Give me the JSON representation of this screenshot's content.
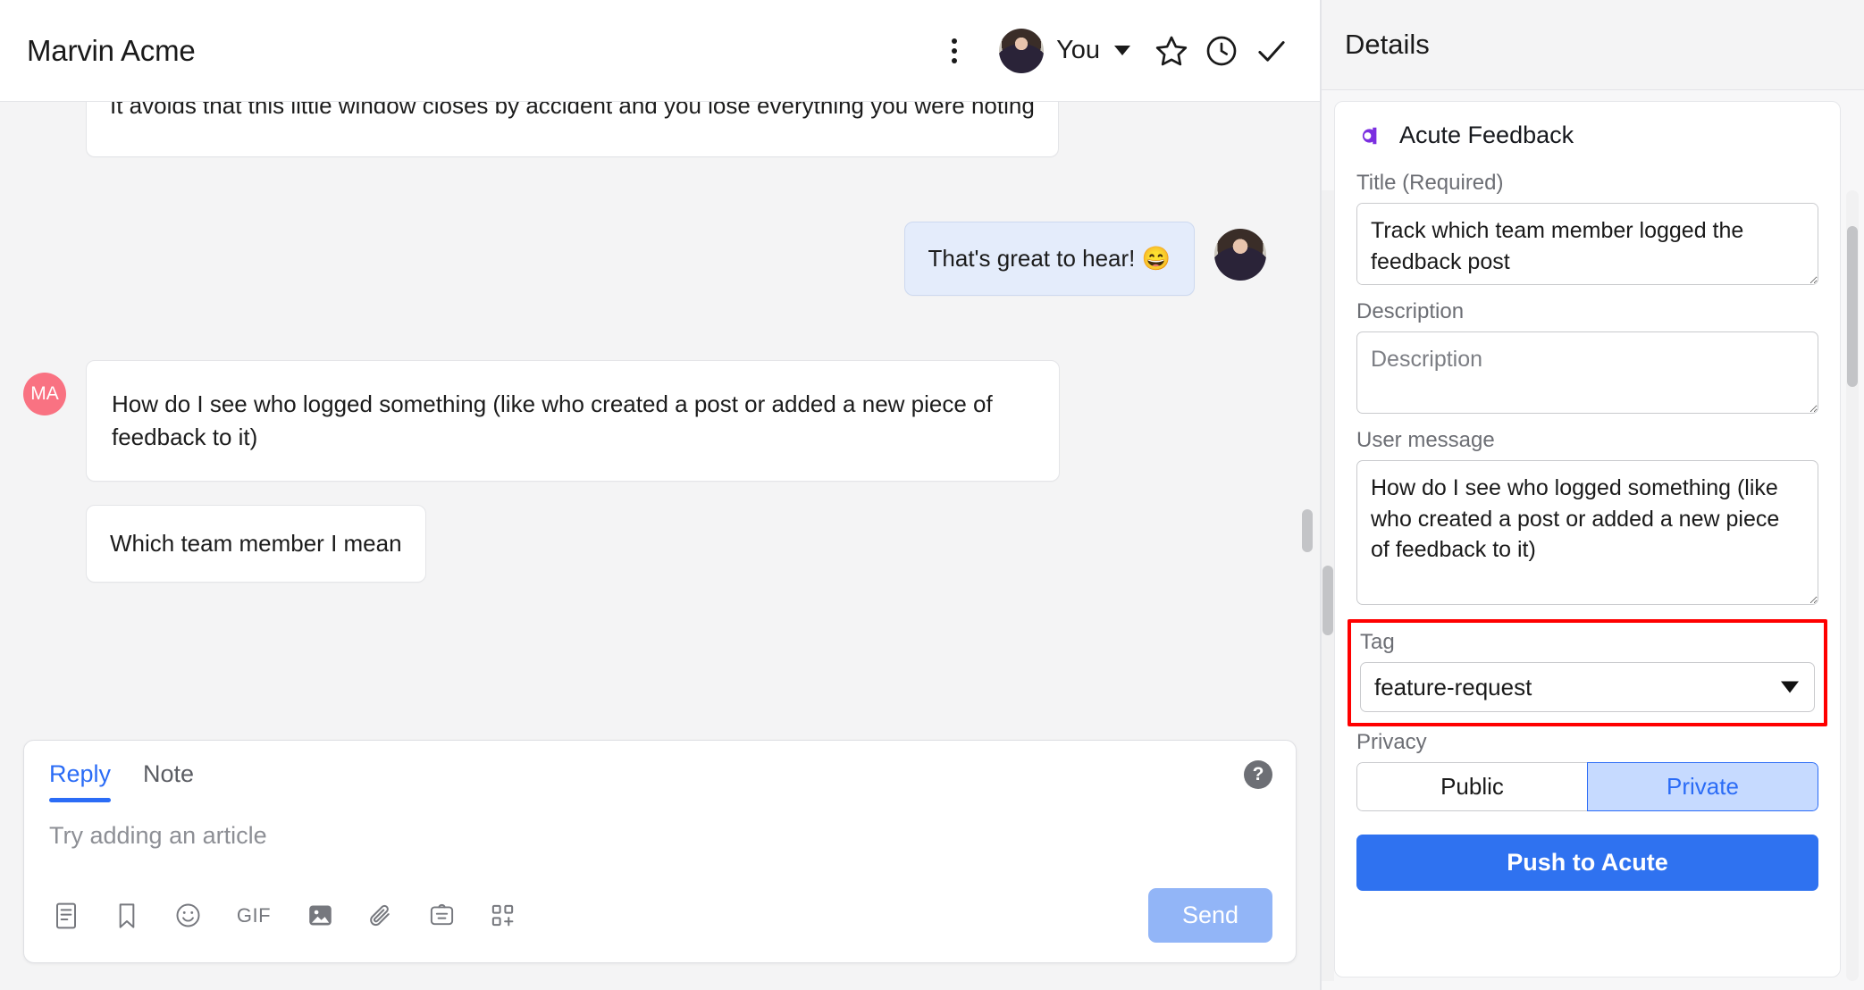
{
  "conversation": {
    "title": "Marvin Acme",
    "header_actions": {
      "more_icon": "kebab-menu-icon",
      "assignee_label": "You",
      "assignee_caret_icon": "chevron-down-icon",
      "star_icon": "star-icon",
      "snooze_icon": "clock-icon",
      "close_icon": "check-icon"
    },
    "messages": [
      {
        "id": "m1",
        "direction": "inbound",
        "clipped_top": true,
        "avatar": "",
        "text": "It avoids that this little window closes by accident and you lose everything you were noting"
      },
      {
        "id": "m2",
        "direction": "outbound",
        "avatar": "you-avatar",
        "text": "That's great to hear! 😄"
      },
      {
        "id": "m3",
        "direction": "inbound",
        "avatar": "MA",
        "text": "How do I see who logged something (like who created a post or added a new piece of feedback to it)"
      },
      {
        "id": "m4",
        "direction": "inbound",
        "avatar": "",
        "text": "Which team member I mean"
      }
    ]
  },
  "composer": {
    "tabs": [
      {
        "label": "Reply",
        "active": true
      },
      {
        "label": "Note",
        "active": false
      }
    ],
    "placeholder": "Try adding an article",
    "help_icon": "question-mark-icon",
    "toolbar_icons": [
      {
        "name": "article-icon",
        "label": ""
      },
      {
        "name": "saved-reply-icon",
        "label": ""
      },
      {
        "name": "emoji-icon",
        "label": ""
      },
      {
        "name": "gif-icon",
        "label": "GIF"
      },
      {
        "name": "image-icon",
        "label": ""
      },
      {
        "name": "attachment-icon",
        "label": ""
      },
      {
        "name": "note-card-icon",
        "label": ""
      },
      {
        "name": "apps-add-icon",
        "label": ""
      }
    ],
    "send_label": "Send"
  },
  "details": {
    "panel_title": "Details",
    "app": {
      "name": "Acute Feedback",
      "logo_icon": "acute-logo-icon",
      "logo_color": "#7B2FE0"
    },
    "fields": {
      "title_label": "Title (Required)",
      "title_value": "Track which team member logged the feedback post",
      "title_placeholder": "Title",
      "description_label": "Description",
      "description_value": "",
      "description_placeholder": "Description",
      "user_message_label": "User message",
      "user_message_value": "How do I see who logged something (like who created a post or added a new piece of feedback to it)",
      "user_message_placeholder": "User message",
      "tag_label": "Tag",
      "tag_value": "feature-request",
      "tag_options": [
        "feature-request"
      ],
      "privacy_label": "Privacy",
      "privacy_options": [
        {
          "label": "Public",
          "selected": false
        },
        {
          "label": "Private",
          "selected": true
        }
      ]
    },
    "submit_label": "Push to Acute",
    "highlight_color": "#ff0000",
    "accent_color": "#2f72f0"
  }
}
